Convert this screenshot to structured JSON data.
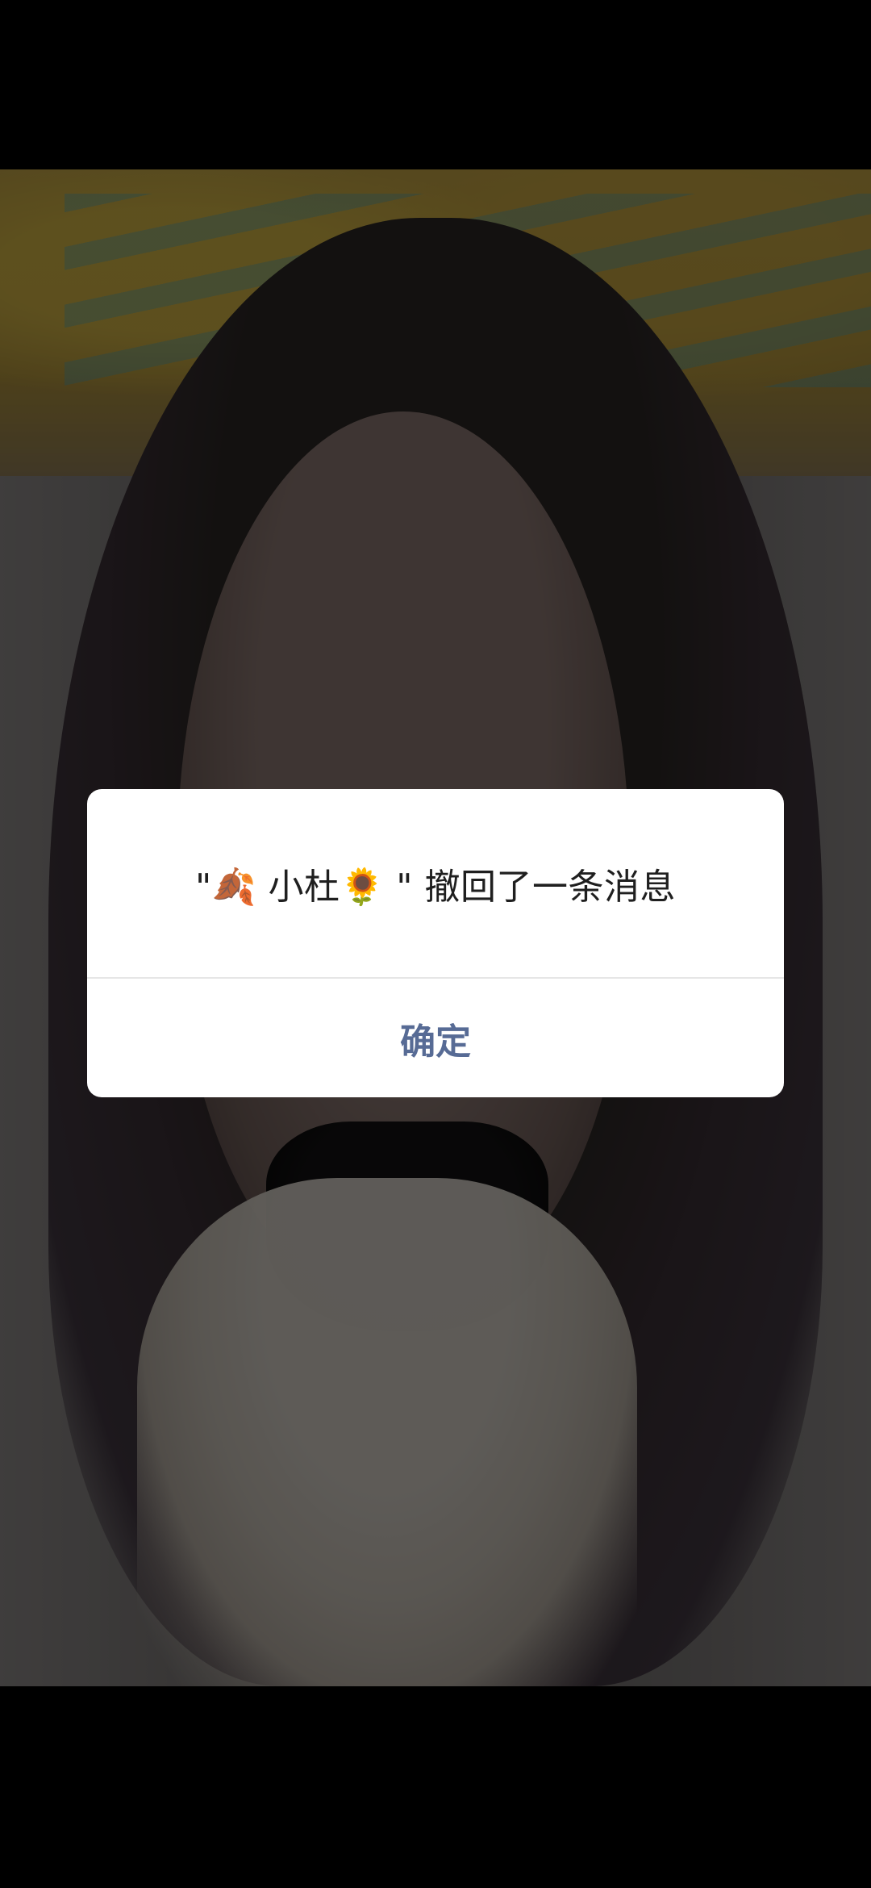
{
  "theme": {
    "dialog_button_color": "#576b95"
  },
  "viewer": {
    "photo_icon": "selfie-photo"
  },
  "dialog": {
    "message": "\"🍂 小杜🌻 \" 撤回了一条消息",
    "confirm_label": "确定"
  }
}
